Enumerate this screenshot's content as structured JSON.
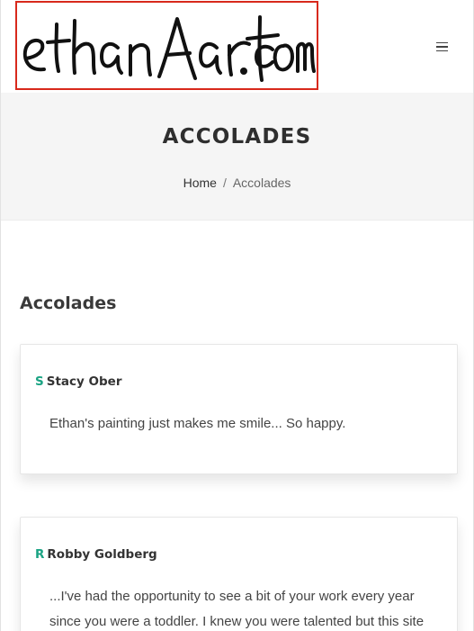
{
  "header": {
    "logo_text": "ethanAart.com",
    "menu_icon": "hamburger-icon"
  },
  "banner": {
    "title": "ACCOLADES",
    "breadcrumb": {
      "home": "Home",
      "separator": "/",
      "current": "Accolades"
    }
  },
  "section": {
    "heading": "Accolades"
  },
  "accolades": [
    {
      "initial": "S",
      "name": "Stacy Ober",
      "quote": "Ethan's painting just makes me smile... So happy."
    },
    {
      "initial": "R",
      "name": "Robby Goldberg",
      "quote": "...I've had the opportunity to see a bit of your work every year since you were a toddler. I knew you were talented but this site"
    }
  ],
  "colors": {
    "accent": "#1aa383",
    "logo_border": "#d8291c",
    "banner_bg": "#f5f5f5"
  }
}
